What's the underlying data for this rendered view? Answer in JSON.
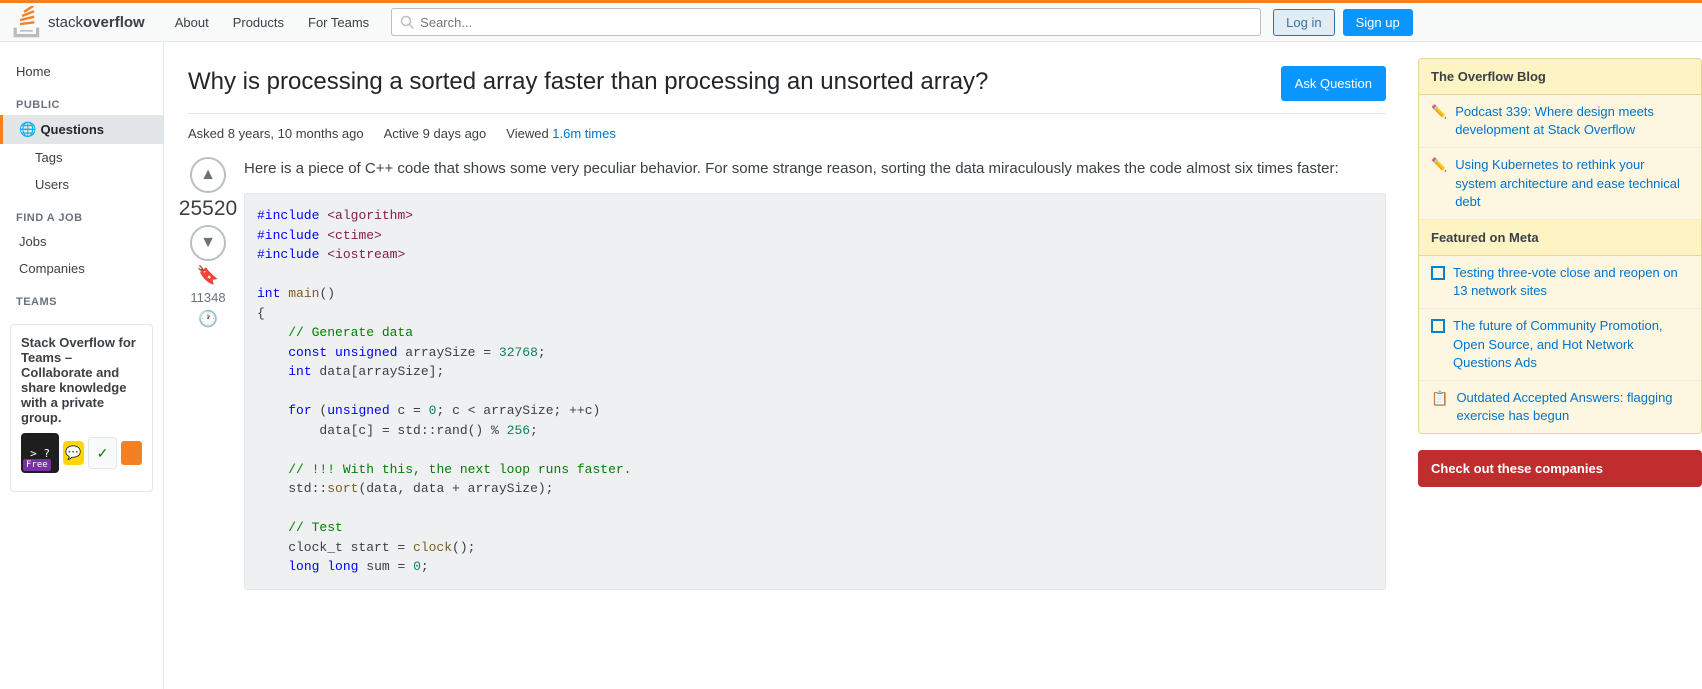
{
  "header": {
    "logo_text_light": "stack",
    "logo_text_bold": "overflow",
    "nav": [
      {
        "label": "About",
        "id": "about"
      },
      {
        "label": "Products",
        "id": "products"
      },
      {
        "label": "For Teams",
        "id": "for-teams"
      }
    ],
    "search_placeholder": "Search...",
    "login_label": "Log in",
    "signup_label": "Sign up"
  },
  "sidebar": {
    "home_label": "Home",
    "public_section": "PUBLIC",
    "questions_label": "Questions",
    "tags_label": "Tags",
    "users_label": "Users",
    "find_a_job_section": "FIND A JOB",
    "jobs_label": "Jobs",
    "companies_label": "Companies",
    "teams_section": "TEAMS",
    "teams_box_title": "Stack Overflow for Teams",
    "teams_box_desc": " – Collaborate and share knowledge with a private group."
  },
  "question": {
    "title": "Why is processing a sorted array faster than processing an unsorted array?",
    "asked_label": "Asked",
    "asked_time": "8 years, 10 months ago",
    "active_label": "Active",
    "active_time": "9 days ago",
    "viewed_label": "Viewed",
    "viewed_count": "1.6m times",
    "vote_count": "25520",
    "bookmark_count": "11348",
    "ask_button": "Ask Question",
    "post_text_1": "Here is a piece of C++ code that shows some very peculiar behavior. For some strange reason, sorting the data miraculously makes the code almost six times faster:",
    "code_lines": [
      "#include <algorithm>",
      "#include <ctime>",
      "#include <iostream>",
      "",
      "int main()",
      "{",
      "    // Generate data",
      "    const unsigned arraySize = 32768;",
      "    int data[arraySize];",
      "",
      "    for (unsigned c = 0; c < arraySize; ++c)",
      "        data[c] = std::rand() % 256;",
      "",
      "    // !!! With this, the next loop runs faster.",
      "    std::sort(data, data + arraySize);",
      "",
      "    // Test",
      "    clock_t start = clock();",
      "    long long sum = 0;"
    ]
  },
  "right_sidebar": {
    "overflow_blog_title": "The Overflow Blog",
    "blog_items": [
      {
        "icon": "pencil",
        "text": "Podcast 339: Where design meets development at Stack Overflow"
      },
      {
        "icon": "pencil",
        "text": "Using Kubernetes to rethink your system architecture and ease technical debt"
      }
    ],
    "featured_meta_title": "Featured on Meta",
    "meta_items": [
      {
        "icon": "checkbox",
        "text": "Testing three-vote close and reopen on 13 network sites"
      },
      {
        "icon": "checkbox",
        "text": "The future of Community Promotion, Open Source, and Hot Network Questions Ads"
      },
      {
        "icon": "notes",
        "text": "Outdated Accepted Answers: flagging exercise has begun"
      }
    ],
    "companies_title": "Check out these companies"
  }
}
